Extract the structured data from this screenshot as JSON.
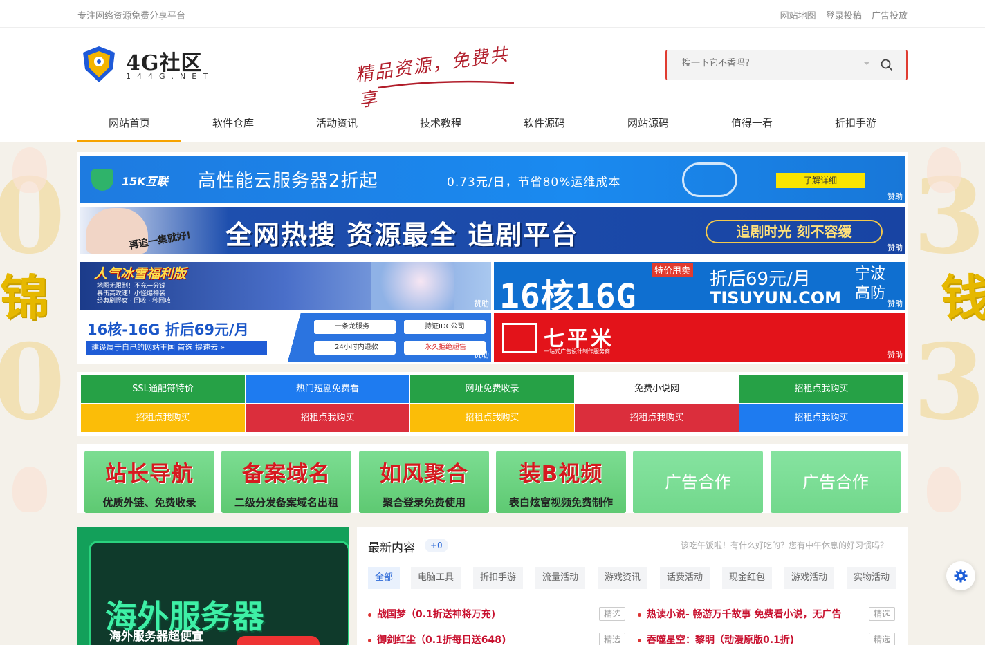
{
  "topbar": {
    "slogan": "专注网络资源免费分享平台",
    "links": [
      "网站地图",
      "登录投稿",
      "广告投放"
    ]
  },
  "header": {
    "brand": "4G社区",
    "domain": "144G.NET",
    "motto": "精品资源，免费共享",
    "search_placeholder": "搜一下它不香吗?",
    "search_icon": "search-icon"
  },
  "nav": {
    "items": [
      "网站首页",
      "软件仓库",
      "活动资讯",
      "技术教程",
      "软件源码",
      "网站源码",
      "值得一看",
      "折扣手游"
    ],
    "active_index": 0,
    "accent": "#f7a300"
  },
  "ads": {
    "sponsor_label": "赞助",
    "b1": {
      "company": "15K互联",
      "main": "高性能云服务器2折起",
      "sub": "0.73元/日，节省80%运维成本",
      "cta": "了解详细"
    },
    "b2": {
      "caption": "再追一集就好!",
      "main": "全网热搜 资源最全 追剧平台",
      "pill": "追剧时光 刻不容缓"
    },
    "b3": {
      "title": "人气冰雪福利版",
      "lines": [
        "地图无限制！不充一分钱",
        "暴击高攻速！小怪爆神装",
        "经典刷怪爽 · 回收 · 秒回收"
      ]
    },
    "b4": {
      "main": "16核16G",
      "special": "特价甩卖",
      "price": "折后69元/月",
      "site": "TISUYUN.COM",
      "region": "宁波高防"
    },
    "b5": {
      "main": "16核-16G 折后69元/月",
      "strip": "建设属于自己的网站王国   首选 提速云  »",
      "chips": [
        "一条龙服务",
        "持证IDC公司",
        "24小时内退款",
        "永久拒绝超售"
      ]
    },
    "b6": {
      "name": "七平米",
      "sub": "一站式广告设计制作服务商"
    }
  },
  "link_grid": [
    {
      "label": "SSL通配符特价",
      "color": "#26a146"
    },
    {
      "label": "热门短剧免费看",
      "color": "#1e7bf0"
    },
    {
      "label": "网址免费收录",
      "color": "#26a146"
    },
    {
      "label": "免费小说网",
      "color": "#ffffff"
    },
    {
      "label": "招租点我购买",
      "color": "#26a146"
    },
    {
      "label": "招租点我购买",
      "color": "#fbbd08"
    },
    {
      "label": "招租点我购买",
      "color": "#db2e3c"
    },
    {
      "label": "招租点我购买",
      "color": "#fbbd08"
    },
    {
      "label": "招租点我购买",
      "color": "#db2e3c"
    },
    {
      "label": "招租点我购买",
      "color": "#1e7bf0"
    }
  ],
  "tiles": [
    {
      "title": "站长导航",
      "sub": "优质外链、免费收录"
    },
    {
      "title": "备案域名",
      "sub": "二级分发备案域名出租"
    },
    {
      "title": "如风聚合",
      "sub": "聚合登录免费使用"
    },
    {
      "title": "装B视频",
      "sub": "表白炫富视频免费制作"
    },
    {
      "title": "广告合作",
      "sub": ""
    },
    {
      "title": "广告合作",
      "sub": ""
    }
  ],
  "promo": {
    "headline": "海外服务器",
    "sub": "海外服务器超便宜"
  },
  "latest": {
    "title": "最新内容",
    "count": "+0",
    "tip": "该吃午饭啦！有什么好吃的？您有中午休息的好习惯吗？",
    "tabs": [
      "全部",
      "电脑工具",
      "折扣手游",
      "流量活动",
      "游戏资讯",
      "话费活动",
      "现金红包",
      "游戏活动",
      "实物活动"
    ],
    "posts": [
      {
        "title": "战国梦（0.1折送神将万充)",
        "badge": "精选"
      },
      {
        "title": "热读小说- 畅游万千故事 免费看小说，无广告",
        "badge": "精选"
      },
      {
        "title": "御剑红尘（0.1折每日送648)",
        "badge": "精选"
      },
      {
        "title": "吞噬星空：黎明（动漫原版0.1折)",
        "badge": "精选"
      }
    ]
  },
  "float": {
    "icon": "gear-icon"
  }
}
